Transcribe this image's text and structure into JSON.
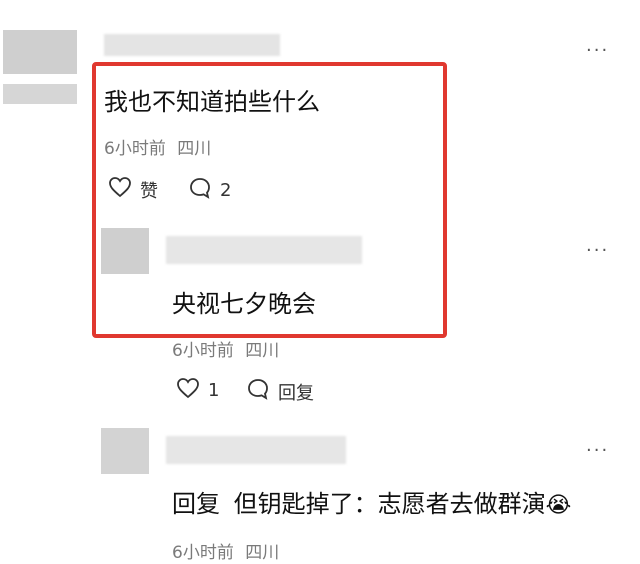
{
  "comments": [
    {
      "text": "我也不知道拍些什么",
      "time": "6小时前",
      "location": "四川",
      "like_label": "赞",
      "reply_count": "2",
      "more": "···"
    },
    {
      "text": "央视七夕晚会",
      "time": "6小时前",
      "location": "四川",
      "like_count": "1",
      "reply_label": "回复",
      "more": "···"
    },
    {
      "reply_prefix": "回复",
      "reply_to": "但钥匙掉了",
      "text": "：志愿者去做群演",
      "emoji": "😭",
      "time": "6小时前",
      "location": "四川",
      "more": "···"
    }
  ],
  "colors": {
    "highlight": "#e0382f",
    "placeholder": "#d9d9d9"
  }
}
